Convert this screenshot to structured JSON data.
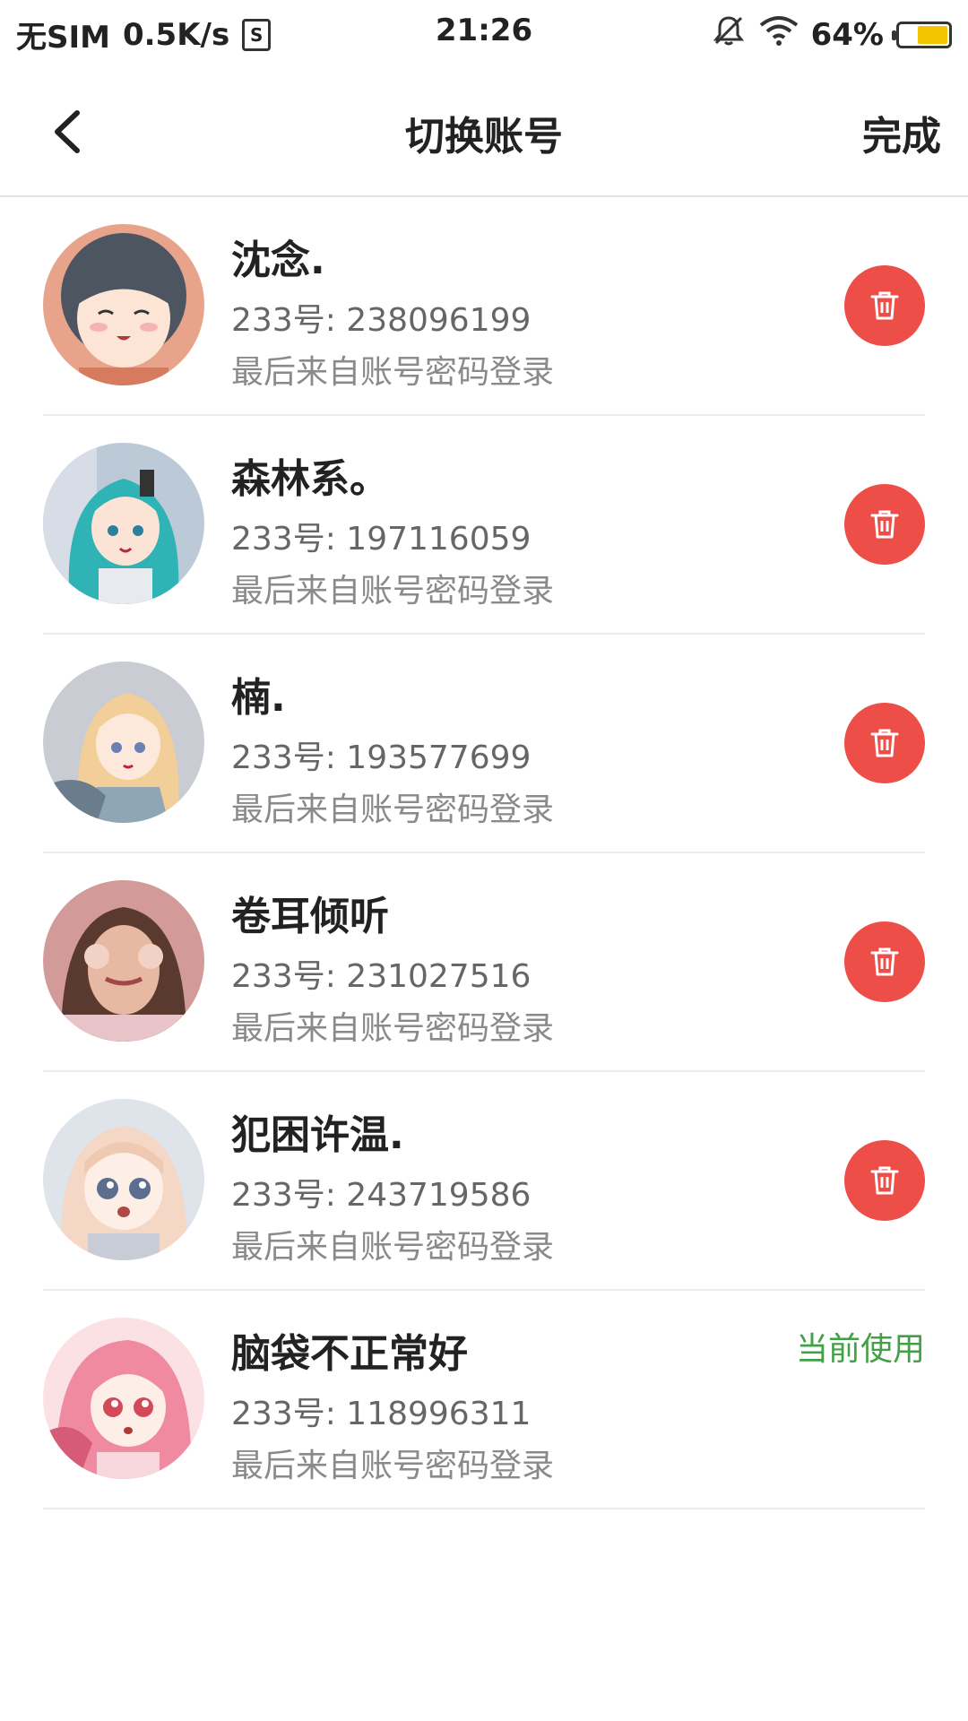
{
  "status_bar": {
    "carrier": "无SIM",
    "speed": "0.5K/s",
    "sim_icon_char": "S",
    "time": "21:26",
    "battery": "64%",
    "battery_level": 0.64,
    "icons": [
      "bell-muted-icon",
      "wifi-icon",
      "battery-icon"
    ]
  },
  "header": {
    "back_icon": "chevron-left-icon",
    "title": "切换账号",
    "done_label": "完成"
  },
  "colors": {
    "delete_button": "#ee4e48",
    "current_badge": "#43a047",
    "battery_fill": "#f3c400"
  },
  "accounts": [
    {
      "name": "沈念.",
      "uid": "233号: 238096199",
      "note": "最后来自账号密码登录",
      "action_icon": "trash-icon"
    },
    {
      "name": "森林系。",
      "uid": "233号: 197116059",
      "note": "最后来自账号密码登录",
      "action_icon": "trash-icon"
    },
    {
      "name": "楠.",
      "uid": "233号: 193577699",
      "note": "最后来自账号密码登录",
      "action_icon": "trash-icon"
    },
    {
      "name": "卷耳倾听",
      "uid": "233号: 231027516",
      "note": "最后来自账号密码登录",
      "action_icon": "trash-icon"
    },
    {
      "name": "犯困许温.",
      "uid": "233号: 243719586",
      "note": "最后来自账号密码登录",
      "action_icon": "trash-icon"
    },
    {
      "name": "脑袋不正常好",
      "uid": "233号: 118996311",
      "note": "最后来自账号密码登录",
      "badge": "当前使用"
    }
  ]
}
